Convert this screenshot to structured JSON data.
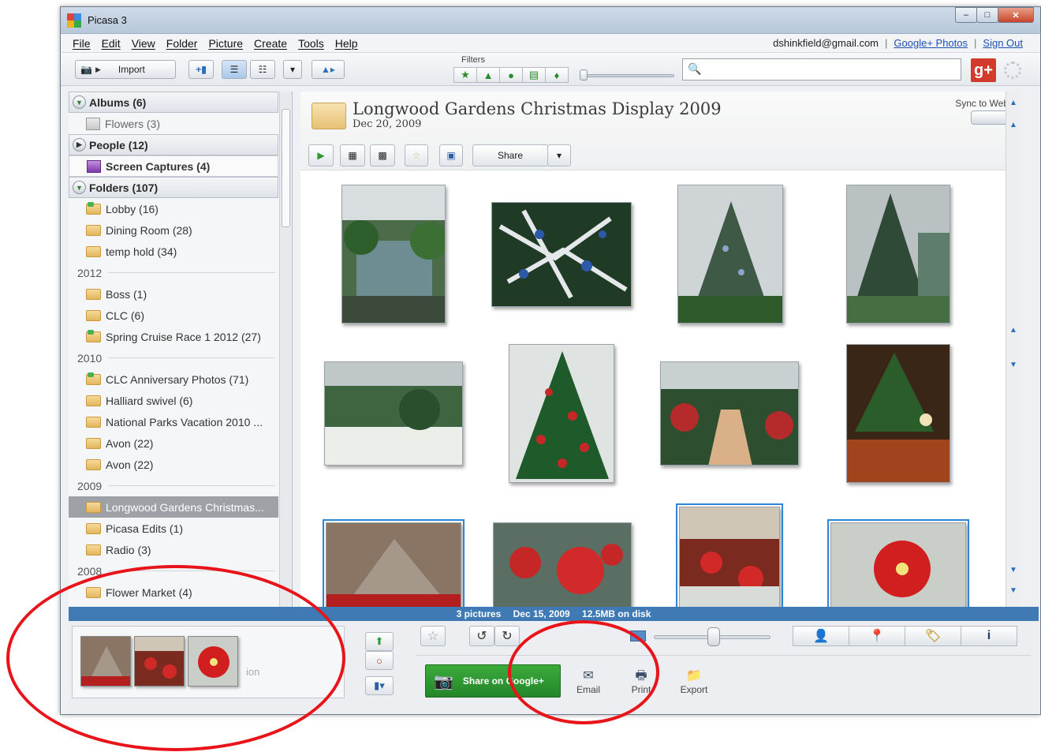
{
  "window": {
    "title": "Picasa 3",
    "controls": {
      "minimize": "–",
      "maximize": "□",
      "close": "✕"
    }
  },
  "menu": {
    "items": [
      "File",
      "Edit",
      "View",
      "Folder",
      "Picture",
      "Create",
      "Tools",
      "Help"
    ]
  },
  "account": {
    "email": "dshinkfield@gmail.com",
    "photos_link": "Google+ Photos",
    "sign_out": "Sign Out",
    "separator": "|"
  },
  "toolbar": {
    "import_label": "Import",
    "filters_label": "Filters",
    "search_placeholder": "",
    "gplus_label": "g+"
  },
  "sidebar": {
    "albums_header": "Albums (6)",
    "flowers": "Flowers (3)",
    "people_header": "People (12)",
    "screen_captures": "Screen Captures (4)",
    "folders_header": "Folders (107)",
    "folders_top": [
      "Lobby (16)",
      "Dining Room (28)",
      "temp hold (34)"
    ],
    "year_2012": "2012",
    "folders_2012": [
      "Boss (1)",
      "CLC (6)",
      "Spring Cruise Race 1 2012 (27)"
    ],
    "year_2010": "2010",
    "folders_2010": [
      "CLC Anniversary Photos (71)",
      "Halliard swivel (6)",
      "National Parks Vacation 2010 ...",
      "Avon (22)",
      "Avon (22)"
    ],
    "year_2009": "2009",
    "folders_2009": [
      "Longwood Gardens Christmas...",
      "Picasa Edits (1)",
      "Radio (3)"
    ],
    "year_2008": "2008",
    "folders_2008": [
      "Flower Market (4)"
    ]
  },
  "album": {
    "title": "Longwood Gardens Christmas Display 2009",
    "date": "Dec 20, 2009",
    "sync_label": "Sync to Web",
    "share_label": "Share"
  },
  "status": {
    "count": "3 pictures",
    "date": "Dec 15, 2009",
    "size": "12.5MB on disk"
  },
  "tray": {
    "faint_label": "ion",
    "share_google": "Share on Google+",
    "email": "Email",
    "print": "Print",
    "export": "Export"
  },
  "icons": {
    "star": "☆",
    "rotate_left": "↺",
    "rotate_right": "↻",
    "person": "👤",
    "pin": "📍",
    "tag": "🏷",
    "info": "i",
    "play": "▶",
    "search": "🔍",
    "camera": "📷",
    "email": "✉",
    "print": "🖶",
    "export": "📁"
  },
  "colors": {
    "status_bar": "#3f7ab5",
    "selection": "#2f86d8",
    "share_green": "#2c9a30",
    "annotation_red": "#e8141a"
  }
}
